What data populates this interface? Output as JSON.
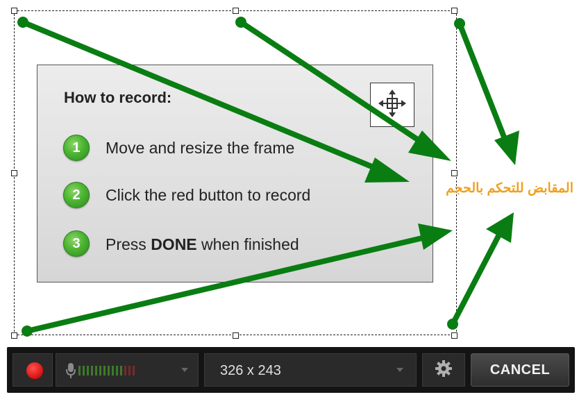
{
  "card": {
    "title": "How to record:",
    "move_icon": "move-arrows-icon",
    "steps": [
      {
        "number": "1",
        "text": "Move and resize the frame"
      },
      {
        "number": "2",
        "text": "Click the red button to record"
      },
      {
        "number": "3",
        "pre": "Press ",
        "bold": "DONE",
        "post": " when finished"
      }
    ]
  },
  "annotation": {
    "callout_text": "المقابض للتحكم بالحجم",
    "callout_color": "#f0a020",
    "arrow_color": "#0a7d12"
  },
  "toolbar": {
    "record_icon": "record-icon",
    "mic_icon": "microphone-icon",
    "size_value": "326 x 243",
    "settings_icon": "gear-icon",
    "cancel_label": "CANCEL",
    "record_color": "#e01515"
  }
}
